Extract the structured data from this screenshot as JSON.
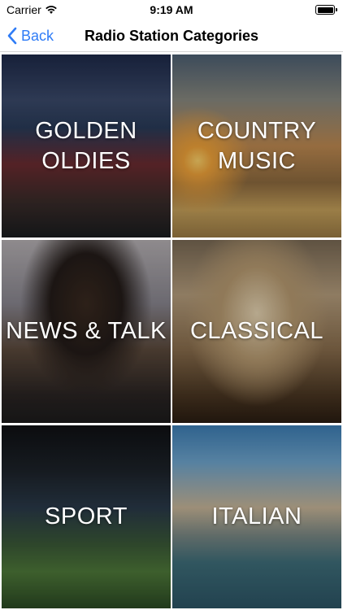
{
  "status_bar": {
    "carrier": "Carrier",
    "time": "9:19 AM"
  },
  "nav": {
    "back_label": "Back",
    "title": "Radio Station Categories"
  },
  "categories": [
    {
      "label": "GOLDEN\nOLDIES"
    },
    {
      "label": "COUNTRY\nMUSIC"
    },
    {
      "label": "NEWS & TALK"
    },
    {
      "label": "CLASSICAL"
    },
    {
      "label": "SPORT"
    },
    {
      "label": "ITALIAN"
    }
  ],
  "colors": {
    "accent": "#2f7cf6",
    "label_text": "#ffffff"
  }
}
